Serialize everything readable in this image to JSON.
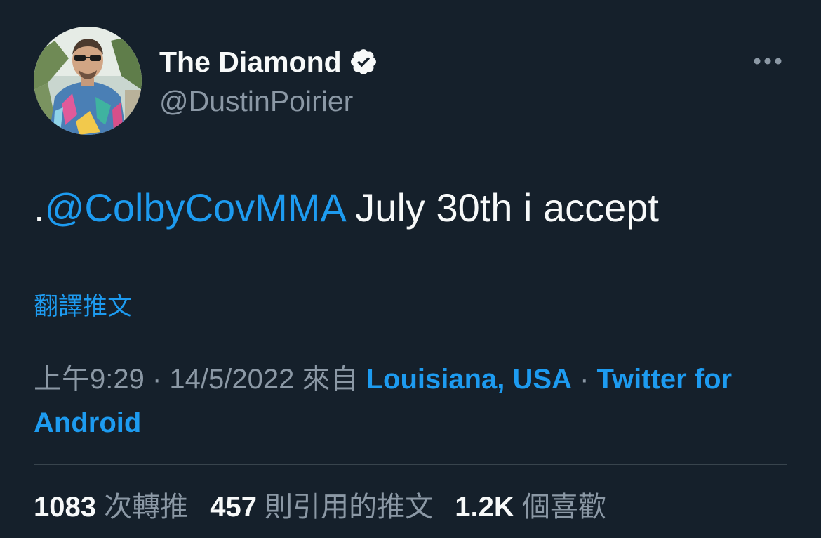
{
  "author": {
    "display_name": "The Diamond",
    "handle": "@DustinPoirier",
    "verified_icon": "verified-badge-icon",
    "avatar_icon": "profile-photo"
  },
  "menu_icon": "more-horizontal-icon",
  "tweet": {
    "prefix": ".",
    "mention": "@ColbyCovMMA",
    "text": " July 30th i accept"
  },
  "translate_label": "翻譯推文",
  "meta": {
    "time": "上午9:29",
    "sep1": " · ",
    "date": "14/5/2022",
    "from_label": " 來自 ",
    "location": "Louisiana, USA",
    "sep2": " · ",
    "source": "Twitter for Android"
  },
  "stats": {
    "retweets_count": "1083",
    "retweets_label": " 次轉推",
    "quotes_count": "457",
    "quotes_label": " 則引用的推文",
    "likes_count": "1.2K",
    "likes_label": " 個喜歡"
  },
  "colors": {
    "background": "#15202b",
    "primary_text": "#f7f9f9",
    "secondary_text": "#8b98a5",
    "accent": "#1d9bf0",
    "divider": "#38444d"
  }
}
